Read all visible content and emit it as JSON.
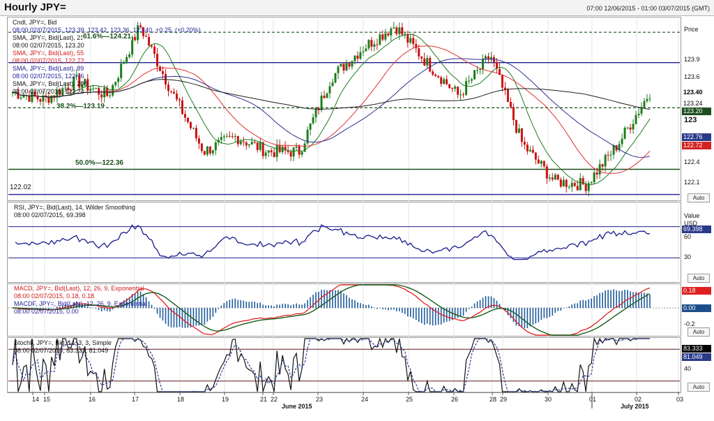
{
  "window": {
    "title": "Hourly JPY=",
    "range": "07:00 12/06/2015 - 01:00 03/07/2015 (GMT)"
  },
  "price_panel": {
    "legend": [
      {
        "text": "Cndl, JPY=, Bid"
      },
      {
        "text": "08:00 02/07/2015, 123.39, 123.42, 123.36, 123.40, +0.25, (+0.20%)"
      },
      {
        "text": "SMA, JPY=, Bid(Last), 21"
      },
      {
        "text": "08:00 02/07/2015, 123.20"
      },
      {
        "text": "SMA, JPY=, Bid(Last), 55"
      },
      {
        "text": "08:00 02/07/2015, 122.72"
      },
      {
        "text": "SMA, JPY=, Bid(Last), 89"
      },
      {
        "text": "08:00 02/07/2015, 122.76"
      },
      {
        "text": "SMA, JPY=, Bid(Last), 200"
      },
      {
        "text": "08:00 02/07/2015, 123.24"
      }
    ],
    "fib_labels": [
      "61.6%—124.21",
      "38.2%—123.19",
      "50.0%—122.36"
    ],
    "level_label": "122.02",
    "axis_title": "Price",
    "axis_ticks": [
      "123.9",
      "123.6",
      "123",
      "122.4",
      "122.1"
    ],
    "tags": [
      "123.40",
      "123.24",
      "123.20",
      "122.76",
      "122.72"
    ],
    "auto": "Auto"
  },
  "rsi_panel": {
    "legend": [
      "RSI, JPY=, Bid(Last), 14, Wilder Smoothing",
      "08:00 02/07/2015, 69.398"
    ],
    "axis_title": "Value",
    "axis_unit": "USD",
    "axis_ticks": [
      "60",
      "30"
    ],
    "tag": "69.398",
    "auto": "Auto"
  },
  "macd_panel": {
    "legend": [
      "MACD, JPY=, Bid(Last), 12, 26, 9, Exponential",
      "08:00 02/07/2015, 0.18, 0.18",
      "MACDF, JPY=, Bid(Last), 12, 26, 9, Exponential",
      "08:00 02/07/2015, 0.00"
    ],
    "axis_ticks": [
      "-0.2"
    ],
    "tags": [
      "0.18",
      "0.00"
    ],
    "auto": "Auto"
  },
  "stoch_panel": {
    "legend": [
      "StochF, JPY=, Bid, 14, 3, 3, Simple",
      "08:00 02/07/2015, 83.333, 81.049"
    ],
    "axis_ticks": [
      "40"
    ],
    "tags": [
      "83.333",
      "81.049"
    ],
    "auto": "Auto"
  },
  "x_axis": {
    "days": [
      "14",
      "15",
      "16",
      "17",
      "18",
      "19",
      "21",
      "22",
      "23",
      "24",
      "25",
      "26",
      "28",
      "29",
      "30",
      "01",
      "02",
      "03"
    ],
    "months": [
      "June 2015",
      "July 2015"
    ]
  },
  "chart_data": {
    "type": "candlestick",
    "title": "Hourly JPY=",
    "ylabel": "Price",
    "ylim": [
      121.95,
      124.4
    ],
    "x_range": [
      "12/06/2015 07:00",
      "03/07/2015 01:00"
    ],
    "horizontal_levels": [
      124.21,
      123.8,
      123.19,
      122.36,
      122.02
    ],
    "close_path_approx": [
      {
        "x": "14",
        "y": 123.4
      },
      {
        "x": "15",
        "y": 123.3
      },
      {
        "x": "16",
        "y": 123.55
      },
      {
        "x": "17",
        "y": 123.35
      },
      {
        "x": "17 late",
        "y": 124.3
      },
      {
        "x": "18",
        "y": 123.4
      },
      {
        "x": "18 late",
        "y": 122.6
      },
      {
        "x": "19",
        "y": 122.8
      },
      {
        "x": "21",
        "y": 122.6
      },
      {
        "x": "22",
        "y": 122.6
      },
      {
        "x": "23",
        "y": 123.6
      },
      {
        "x": "24",
        "y": 124.0
      },
      {
        "x": "24 late",
        "y": 124.3
      },
      {
        "x": "25",
        "y": 123.8
      },
      {
        "x": "26",
        "y": 123.35
      },
      {
        "x": "28",
        "y": 123.9
      },
      {
        "x": "29",
        "y": 122.7
      },
      {
        "x": "30",
        "y": 122.2
      },
      {
        "x": "30 late",
        "y": 122.15
      },
      {
        "x": "01",
        "y": 122.7
      },
      {
        "x": "02",
        "y": 123.4
      }
    ],
    "indicators": {
      "SMA21": 123.2,
      "SMA55": 122.72,
      "SMA89": 122.76,
      "SMA200": 123.24,
      "RSI14": 69.398,
      "MACD": 0.18,
      "MACD_signal": 0.18,
      "MACDF": 0.0,
      "StochF_K": 83.333,
      "StochF_D": 81.049
    },
    "colors": {
      "bull": "#1e7d1e",
      "bear": "#cc1111",
      "sma21": "#1f7a1f",
      "sma55": "#e03030",
      "sma89": "#303090",
      "sma200": "#202020"
    }
  }
}
